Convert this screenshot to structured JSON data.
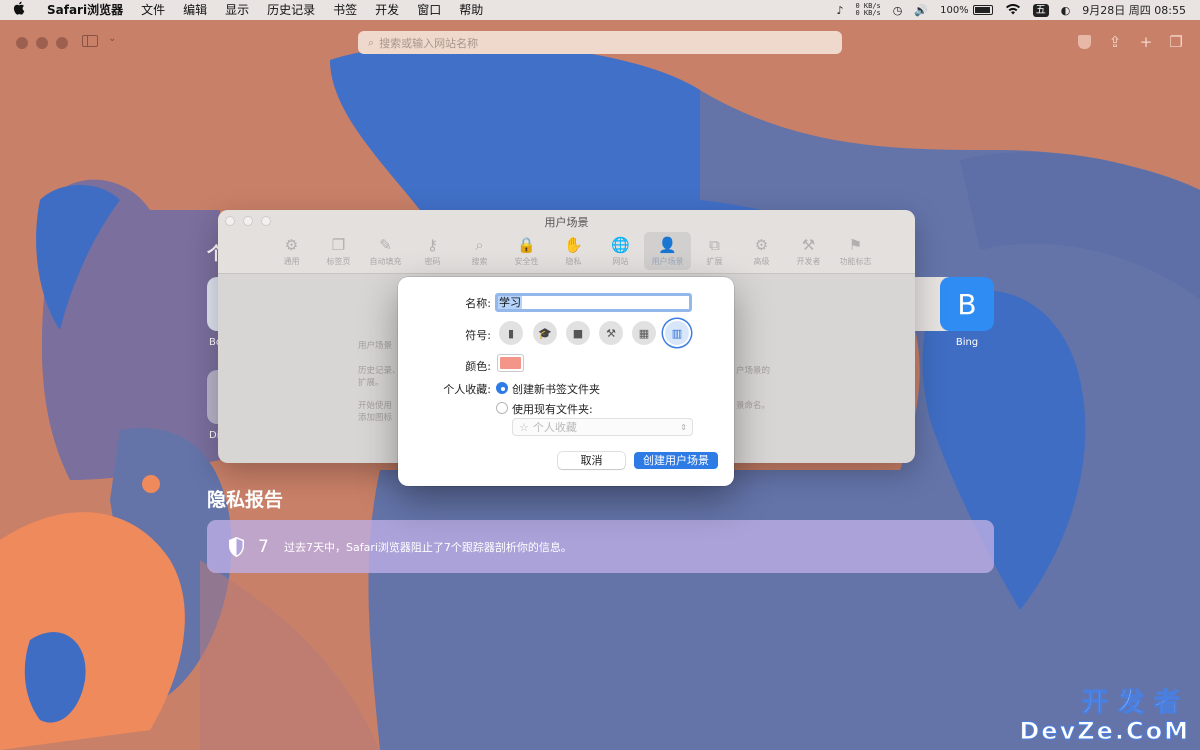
{
  "menubar": {
    "apple": "",
    "items": [
      "Safari浏览器",
      "文件",
      "编辑",
      "显示",
      "历史记录",
      "书签",
      "开发",
      "窗口",
      "帮助"
    ],
    "net_up": "0 KB/s",
    "net_down": "0 KB/s",
    "battery": "100%",
    "input_method": "五",
    "clock": "9月28日 周四  08:55"
  },
  "toolbar": {
    "search_placeholder": "搜索或输入网站名称"
  },
  "start_page": {
    "favorites_heading_fragment": "个",
    "fav_left_caption": "Bo",
    "fav_left2_caption": "Di",
    "bing_letter": "B",
    "bing_caption": "Bing",
    "privacy_title": "隐私报告",
    "privacy_count": "7",
    "privacy_text": "过去7天中，Safari浏览器阻止了7个跟踪器剖析你的信息。"
  },
  "prefs": {
    "title": "用户场景",
    "tabs": [
      {
        "icon": "gear-icon",
        "glyph": "⚙",
        "label": "通用"
      },
      {
        "icon": "tabs-icon",
        "glyph": "❐",
        "label": "标签页"
      },
      {
        "icon": "autofill-icon",
        "glyph": "✎",
        "label": "自动填充"
      },
      {
        "icon": "key-icon",
        "glyph": "⚷",
        "label": "密码"
      },
      {
        "icon": "search-icon",
        "glyph": "⌕",
        "label": "搜索"
      },
      {
        "icon": "lock-icon",
        "glyph": "🔒",
        "label": "安全性"
      },
      {
        "icon": "hand-icon",
        "glyph": "✋",
        "label": "隐私"
      },
      {
        "icon": "globe-icon",
        "glyph": "🌐",
        "label": "网站"
      },
      {
        "icon": "person-icon",
        "glyph": "👤",
        "label": "用户场景"
      },
      {
        "icon": "puzzle-icon",
        "glyph": "⧉",
        "label": "扩展"
      },
      {
        "icon": "gears-icon",
        "glyph": "⚙",
        "label": "高级"
      },
      {
        "icon": "tools-icon",
        "glyph": "⚒",
        "label": "开发者"
      },
      {
        "icon": "flags-icon",
        "glyph": "⚑",
        "label": "功能标志"
      }
    ],
    "bg_text_1": "用户场景",
    "bg_text_2a": "历史记录、",
    "bg_text_2b": "扩展。",
    "bg_text_3a": "开始使用",
    "bg_text_3b": "添加图标",
    "bg_text_r1": "户场景的",
    "bg_text_r2": "景命名。"
  },
  "dialog": {
    "name_label": "名称:",
    "name_value": "学习",
    "symbol_label": "符号:",
    "symbols": [
      {
        "icon": "id-badge-icon",
        "glyph": "▮"
      },
      {
        "icon": "graduation-cap-icon",
        "glyph": "🎓"
      },
      {
        "icon": "briefcase-icon",
        "glyph": "■"
      },
      {
        "icon": "hammer-icon",
        "glyph": "⚒"
      },
      {
        "icon": "building-icon",
        "glyph": "▦"
      },
      {
        "icon": "books-icon",
        "glyph": "▥"
      }
    ],
    "selected_symbol": "books-icon",
    "color_label": "颜色:",
    "color_value": "#f4958a",
    "favorites_label": "个人收藏:",
    "option_new_folder": "创建新书签文件夹",
    "option_existing_folder": "使用现有文件夹:",
    "selected_option": "new_folder",
    "folder_select_value": "个人收藏",
    "cancel_label": "取消",
    "create_label": "创建用户场景"
  },
  "watermark": {
    "line1": "开发者",
    "line2": "DevZe.CoM"
  },
  "colors": {
    "accent": "#2f7be5",
    "wallpaper_orange": "#c98068",
    "wallpaper_blue": "#3f6dc3"
  }
}
